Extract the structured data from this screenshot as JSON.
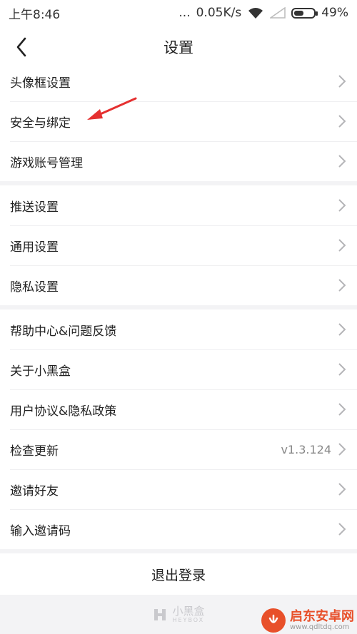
{
  "status_bar": {
    "time": "上午8:46",
    "dots": "...",
    "speed": "0.05K/s",
    "battery": "49%",
    "battery_level": 0.49
  },
  "nav": {
    "title": "设置"
  },
  "groups": [
    {
      "items": [
        {
          "label": "头像框设置"
        },
        {
          "label": "安全与绑定"
        },
        {
          "label": "游戏账号管理"
        }
      ]
    },
    {
      "items": [
        {
          "label": "推送设置"
        },
        {
          "label": "通用设置"
        },
        {
          "label": "隐私设置"
        }
      ]
    },
    {
      "items": [
        {
          "label": "帮助中心&问题反馈"
        },
        {
          "label": "关于小黑盒"
        },
        {
          "label": "用户协议&隐私政策"
        },
        {
          "label": "检查更新",
          "value": "v1.3.124"
        },
        {
          "label": "邀请好友"
        },
        {
          "label": "输入邀请码"
        }
      ]
    }
  ],
  "logout": {
    "label": "退出登录"
  },
  "footer": {
    "logo_cn": "小黑盒",
    "logo_en": "HEYBOX"
  },
  "watermark": {
    "name": "启东安卓网",
    "url": "www.qdltdq.com"
  },
  "colors": {
    "annotation_arrow": "#e53030",
    "watermark_accent": "#e8502a"
  }
}
